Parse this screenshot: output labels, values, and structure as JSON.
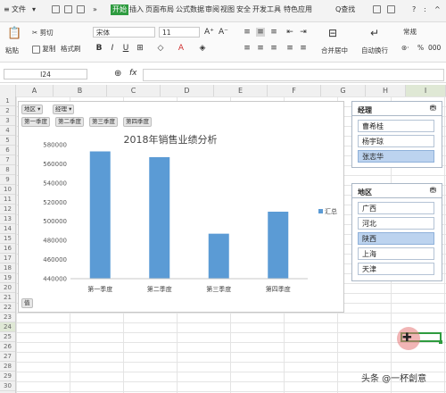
{
  "titlebar": {
    "menu_icon": "hamburger-icon",
    "file_label": "文件",
    "tabs": [
      "开始",
      "插入",
      "页面布局",
      "公式",
      "数据",
      "审阅",
      "视图",
      "安全",
      "开发工具",
      "特色应用"
    ],
    "active_tab_index": 0,
    "search_label": "Q查找",
    "help_label": "?"
  },
  "ribbon": {
    "paste": "粘贴",
    "cut": "剪切",
    "copy": "复制",
    "format_painter": "格式刷",
    "font_name": "宋体",
    "font_size": "11",
    "bold": "B",
    "italic": "I",
    "underline": "U",
    "grow_font": "A⁺",
    "shrink_font": "A⁻",
    "merge_center": "合并居中",
    "wrap_text": "自动换行",
    "number_format": "常规",
    "percent": "%",
    "thousands": "000"
  },
  "formula_bar": {
    "cell_ref": "I24",
    "fx_label": "fx"
  },
  "grid": {
    "columns": [
      "A",
      "B",
      "C",
      "D",
      "E",
      "F",
      "G",
      "H",
      "I"
    ],
    "rows": [
      "1",
      "2",
      "3",
      "4",
      "5",
      "6",
      "7",
      "8",
      "9",
      "10",
      "11",
      "12",
      "13",
      "14",
      "15",
      "16",
      "17",
      "18",
      "19",
      "20",
      "21",
      "22",
      "23",
      "24",
      "25",
      "26",
      "27",
      "28",
      "29",
      "30"
    ]
  },
  "chart_data": {
    "type": "bar",
    "title": "2018年销售业绩分析",
    "categories": [
      "第一季度",
      "第二季度",
      "第三季度",
      "第四季度"
    ],
    "series": [
      {
        "name": "汇总",
        "values": [
          573000,
          567000,
          487000,
          510000
        ]
      }
    ],
    "ylim": [
      440000,
      580000
    ],
    "yticks": [
      440000,
      460000,
      480000,
      500000,
      520000,
      540000,
      560000,
      580000
    ],
    "ytick_labels": [
      "440000",
      "460000",
      "480000",
      "500000",
      "520000",
      "540000",
      "560000",
      "580000"
    ],
    "color": "#5b9bd5",
    "legend_position": "right",
    "grid": false
  },
  "chart_filters": {
    "field_buttons": [
      "地区",
      "经理"
    ],
    "quarter_buttons": [
      "第一季度",
      "第二季度",
      "第三季度",
      "第四季度"
    ],
    "value_button": "值"
  },
  "slicer_manager": {
    "title": "经理",
    "items": [
      "曹希桂",
      "杨宇琼",
      "张志华"
    ],
    "selected": [
      2
    ]
  },
  "slicer_region": {
    "title": "地区",
    "items": [
      "广西",
      "河北",
      "陕西",
      "上海",
      "天津"
    ],
    "selected": [
      2
    ]
  },
  "watermark": "头条 @一杯創意"
}
